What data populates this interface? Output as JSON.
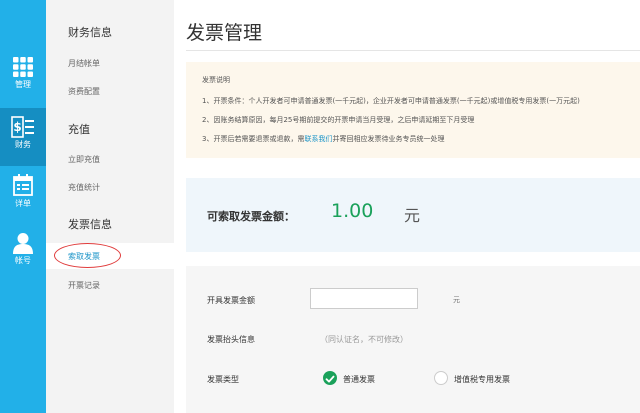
{
  "rail": {
    "items": [
      {
        "label": "管理",
        "icon": "grid-icon"
      },
      {
        "label": "财务",
        "icon": "finance-icon",
        "active": true
      },
      {
        "label": "详单",
        "icon": "calendar-list-icon"
      },
      {
        "label": "帐号",
        "icon": "user-icon"
      }
    ]
  },
  "submenu": {
    "sections": [
      {
        "title": "财务信息",
        "items": [
          "月结帐单",
          "资费配置"
        ]
      },
      {
        "title": "充值",
        "items": [
          "立即充值",
          "充值统计"
        ]
      },
      {
        "title": "发票信息",
        "items": [
          "索取发票",
          "开票记录"
        ]
      }
    ],
    "active_item": "索取发票"
  },
  "main": {
    "title": "发票管理",
    "notice": {
      "title": "发票说明",
      "line1": "1、开票条件：个人开发者可申请普通发票(一千元起)，企业开发者可申请普通发票(一千元起)或增值税专用发票(一万元起)",
      "line2": "2、因账务结算原因，每月25号期前提交的开票申请当月受理，之后申请延期至下月受理",
      "line3_pre": "3、开票后若需要退票或退款，需",
      "line3_link": "联系我们",
      "line3_post": "并寄回相应发票待业务专员统一处理"
    },
    "amount": {
      "label": "可索取发票金额：",
      "value": "1.00",
      "unit": "元"
    },
    "form": {
      "amount_label": "开具发票金额",
      "amount_value": "",
      "amount_unit": "元",
      "header_label": "发票抬头信息",
      "header_hint": "（同认证名，不可修改）",
      "type_label": "发票类型",
      "type_options": [
        "普通发票",
        "增值税专用发票"
      ],
      "type_selected": "普通发票"
    }
  },
  "colors": {
    "rail": "#22b0e8",
    "rail_active": "#158ec2",
    "accent_green": "#1aa15a",
    "link_blue": "#1d95c8",
    "highlight_red": "#e03c3c"
  }
}
